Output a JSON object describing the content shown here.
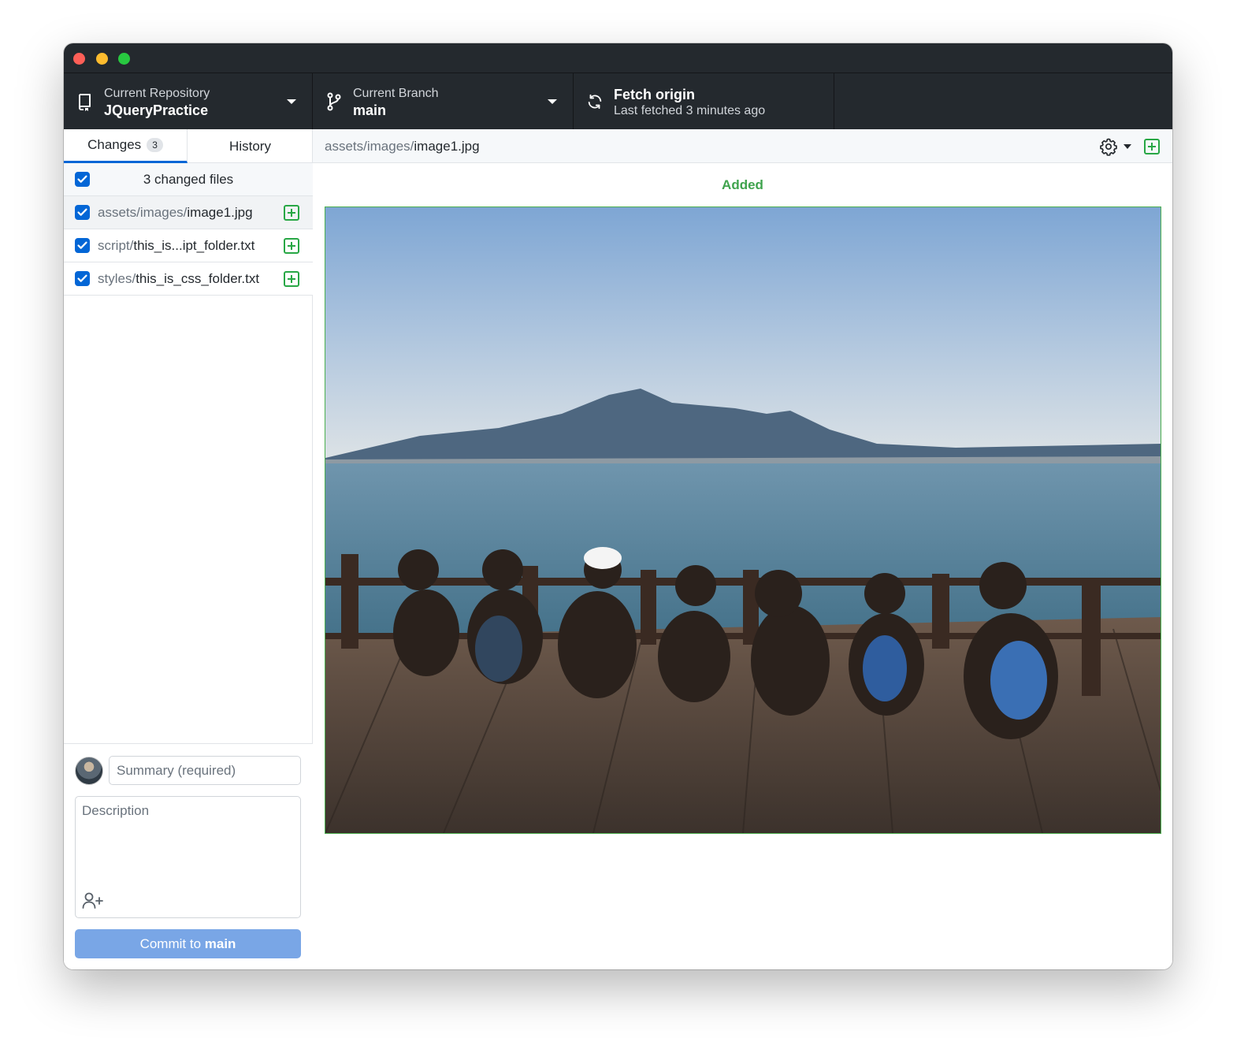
{
  "toolbar": {
    "repository": {
      "label": "Current Repository",
      "value": "JQueryPractice"
    },
    "branch": {
      "label": "Current Branch",
      "value": "main"
    },
    "fetch": {
      "label": "Fetch origin",
      "status": "Last fetched 3 minutes ago"
    }
  },
  "sidebar": {
    "tabs": [
      {
        "label": "Changes",
        "count": "3",
        "active": true
      },
      {
        "label": "History"
      }
    ],
    "changed_files_label": "3 changed files",
    "files": [
      {
        "dir": "assets/images/",
        "name": "image1.jpg",
        "status": "added",
        "selected": true
      },
      {
        "dir": "script/",
        "name": "this_is...ipt_folder.txt",
        "status": "added"
      },
      {
        "dir": "styles/",
        "name": "this_is_css_folder.txt",
        "status": "added"
      }
    ]
  },
  "commit": {
    "summary_placeholder": "Summary (required)",
    "description_placeholder": "Description",
    "button_prefix": "Commit to ",
    "button_branch": "main"
  },
  "diff": {
    "path_dir": "assets/images/",
    "path_file": "image1.jpg",
    "status_label": "Added"
  },
  "colors": {
    "toolbar_bg": "#24292e",
    "accent_blue": "#0366d6",
    "added_green": "#28a745",
    "commit_button": "#79a6e6"
  },
  "icons": [
    "repo-icon",
    "branch-icon",
    "sync-icon",
    "gear-icon",
    "plus-square-icon",
    "person-add-icon",
    "checkmark-icon"
  ]
}
